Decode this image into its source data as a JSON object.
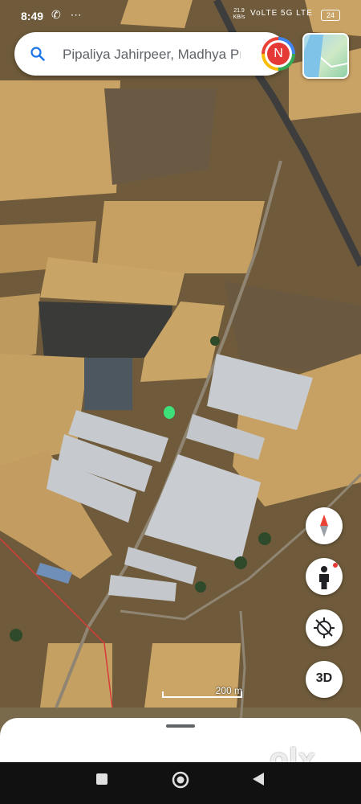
{
  "status_bar": {
    "time": "8:49",
    "left_icons": "✆ ⋯",
    "speed_value": "21.9",
    "speed_unit": "KB/s",
    "network": "VoLTE 5G LTE",
    "battery": "24"
  },
  "search": {
    "query": "Pipaliya Jahirpeer, Madhya Pı",
    "avatar_letter": "N"
  },
  "map": {
    "scale_label": "200 m"
  },
  "controls": {
    "three_d_label": "3D"
  },
  "watermark": {
    "text": "olx"
  },
  "colors": {
    "avatar_red": "#e53935",
    "compass_red": "#ea4335",
    "nav_bar": "#111111"
  },
  "icons": [
    "search-icon",
    "compass-icon",
    "street-view-icon",
    "gps-off-icon",
    "recents-icon",
    "home-icon",
    "back-icon"
  ]
}
